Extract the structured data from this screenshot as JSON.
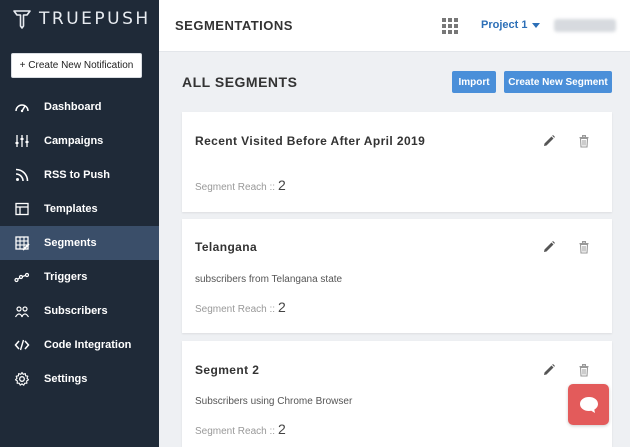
{
  "brand": {
    "name": "TRUEPUSH",
    "icon": "truepush-logo-icon"
  },
  "sidebar": {
    "create_label": "+ Create New Notification",
    "items": [
      {
        "label": "Dashboard",
        "icon": "dashboard-icon",
        "active": false
      },
      {
        "label": "Campaigns",
        "icon": "sliders-icon",
        "active": false
      },
      {
        "label": "RSS to Push",
        "icon": "rss-icon",
        "active": false
      },
      {
        "label": "Templates",
        "icon": "templates-icon",
        "active": false
      },
      {
        "label": "Segments",
        "icon": "segments-icon",
        "active": true
      },
      {
        "label": "Triggers",
        "icon": "triggers-icon",
        "active": false
      },
      {
        "label": "Subscribers",
        "icon": "subscribers-icon",
        "active": false
      },
      {
        "label": "Code Integration",
        "icon": "code-icon",
        "active": false
      },
      {
        "label": "Settings",
        "icon": "gear-icon",
        "active": false
      }
    ]
  },
  "topbar": {
    "title": "SEGMENTATIONS",
    "project_label": "Project 1",
    "apps_icon": "apps-grid-icon"
  },
  "main": {
    "section_title": "ALL SEGMENTS",
    "import_label": "Import",
    "create_segment_label": "Create New Segment",
    "segments": [
      {
        "title": "Recent Visited Before After April 2019",
        "description": "",
        "reach_label": "Segment Reach ::",
        "reach_value": "2"
      },
      {
        "title": "Telangana",
        "description": "subscribers from Telangana state",
        "reach_label": "Segment Reach ::",
        "reach_value": "2"
      },
      {
        "title": "Segment 2",
        "description": "Subscribers using Chrome Browser",
        "reach_label": "Segment Reach ::",
        "reach_value": "2"
      }
    ]
  },
  "colors": {
    "sidebar_bg": "#1f2a38",
    "sidebar_active": "#3a4e69",
    "accent_blue": "#4a8fd9",
    "link_blue": "#2c6fb7",
    "chat_red": "#e35b5b"
  },
  "chat": {
    "icon": "chat-bubble-icon"
  }
}
